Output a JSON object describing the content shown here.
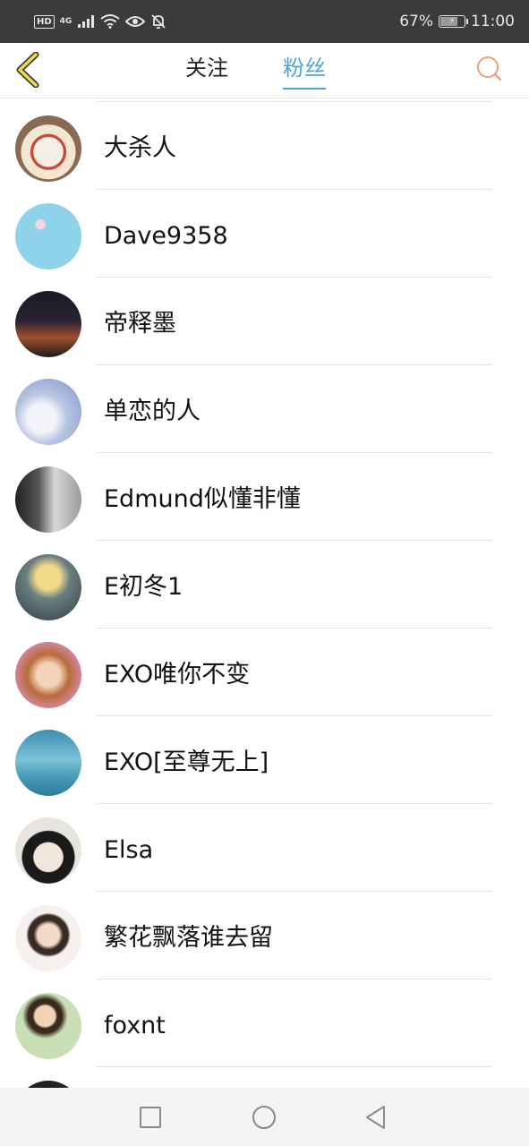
{
  "status_bar": {
    "hd": "HD",
    "network": "4G",
    "battery_percent": "67%",
    "battery_level": 0.67,
    "time": "11:00",
    "icons": [
      "signal-icon",
      "wifi-icon",
      "eye-icon",
      "bell-off-icon",
      "battery-icon"
    ]
  },
  "header": {
    "back_icon": "chevron-left-icon",
    "tabs": [
      {
        "label": "关注",
        "active": false
      },
      {
        "label": "粉丝",
        "active": true
      }
    ],
    "search_icon": "search-icon",
    "active_color": "#4aa6d6"
  },
  "fans": [
    {
      "name": "大杀人"
    },
    {
      "name": "Dave9358"
    },
    {
      "name": "帝释墨"
    },
    {
      "name": "单恋的人"
    },
    {
      "name": "Edmund似懂非懂"
    },
    {
      "name": "E初冬1"
    },
    {
      "name": "EXO唯你不变"
    },
    {
      "name": "EXO[至尊无上]"
    },
    {
      "name": "Elsa"
    },
    {
      "name": "繁花飘落谁去留"
    },
    {
      "name": "foxnt"
    }
  ],
  "nav_bar": {
    "icons": [
      "recent-apps-icon",
      "home-icon",
      "back-icon"
    ]
  }
}
